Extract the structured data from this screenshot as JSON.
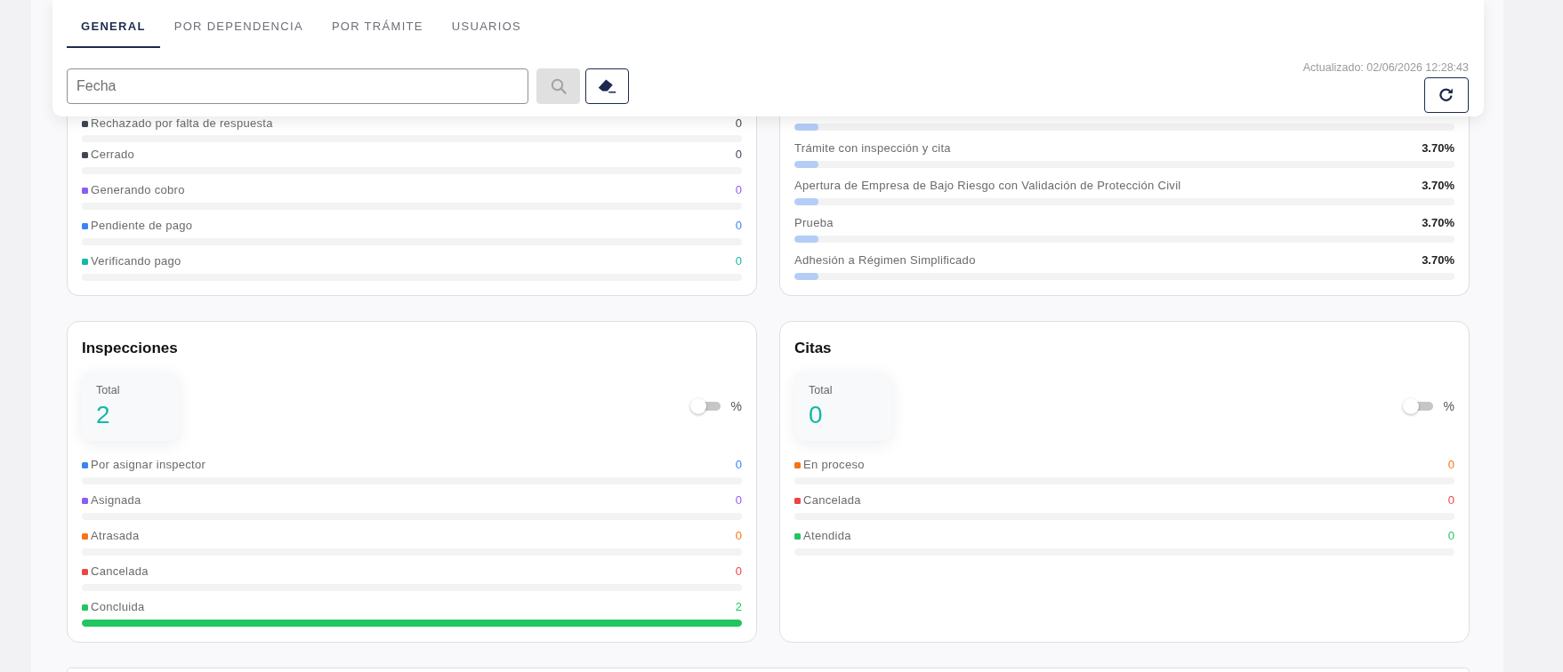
{
  "tabs": [
    {
      "label": "GENERAL",
      "selected": true
    },
    {
      "label": "POR DEPENDENCIA",
      "selected": false
    },
    {
      "label": "POR TRÁMITE",
      "selected": false
    },
    {
      "label": "USUARIOS",
      "selected": false
    }
  ],
  "filters": {
    "date_field": {
      "placeholder": "Fecha"
    },
    "search_button": {
      "disabled": true
    },
    "updated": "Actualizado: 02/06/2026 12:28:43"
  },
  "status_card": {
    "items": [
      {
        "label": "Rechazado por falta de respuesta",
        "value": "0",
        "color": "#3f4654",
        "level": 0
      },
      {
        "label": "Cerrado",
        "value": "0",
        "color": "#3f4654",
        "level": 0
      },
      {
        "label": "Generando cobro",
        "value": "0",
        "color": "#8b5cf6",
        "level": 0
      },
      {
        "label": "Pendiente de pago",
        "value": "0",
        "color": "#3b82f6",
        "level": 0
      },
      {
        "label": "Verificando pago",
        "value": "0",
        "color": "#14b8a6",
        "level": 0
      }
    ]
  },
  "procedures_card": {
    "items": [
      {
        "level": 0.037
      },
      {
        "label": "Trámite con inspección y cita",
        "value": "3.70%",
        "level": 0.037
      },
      {
        "label": "Apertura de Empresa de Bajo Riesgo con Validación de Protección Civil",
        "value": "3.70%",
        "level": 0.037
      },
      {
        "label": "Prueba",
        "value": "3.70%",
        "level": 0.037
      },
      {
        "label": "Adhesión a Régimen Simplificado",
        "value": "3.70%",
        "level": 0.037
      }
    ]
  },
  "inspecciones": {
    "title": "Inspecciones",
    "total_label": "Total",
    "total": "2",
    "percent_toggle": {
      "on": false,
      "label": "%"
    },
    "items": [
      {
        "label": "Por asignar inspector",
        "value": "0",
        "color": "#3b82f6",
        "level": 0
      },
      {
        "label": "Asignada",
        "value": "0",
        "color": "#8b5cf6",
        "level": 0
      },
      {
        "label": "Atrasada",
        "value": "0",
        "color": "#f97316",
        "level": 0
      },
      {
        "label": "Cancelada",
        "value": "0",
        "color": "#ef4444",
        "level": 0
      },
      {
        "label": "Concluida",
        "value": "2",
        "color": "#22c55e",
        "level": 1
      }
    ]
  },
  "citas": {
    "title": "Citas",
    "total_label": "Total",
    "total": "0",
    "percent_toggle": {
      "on": false,
      "label": "%"
    },
    "items": [
      {
        "label": "En proceso",
        "value": "0",
        "color": "#f97316",
        "level": 0
      },
      {
        "label": "Cancelada",
        "value": "0",
        "color": "#ef4444",
        "level": 0
      },
      {
        "label": "Atendida",
        "value": "0",
        "color": "#22c55e",
        "level": 0
      }
    ]
  }
}
